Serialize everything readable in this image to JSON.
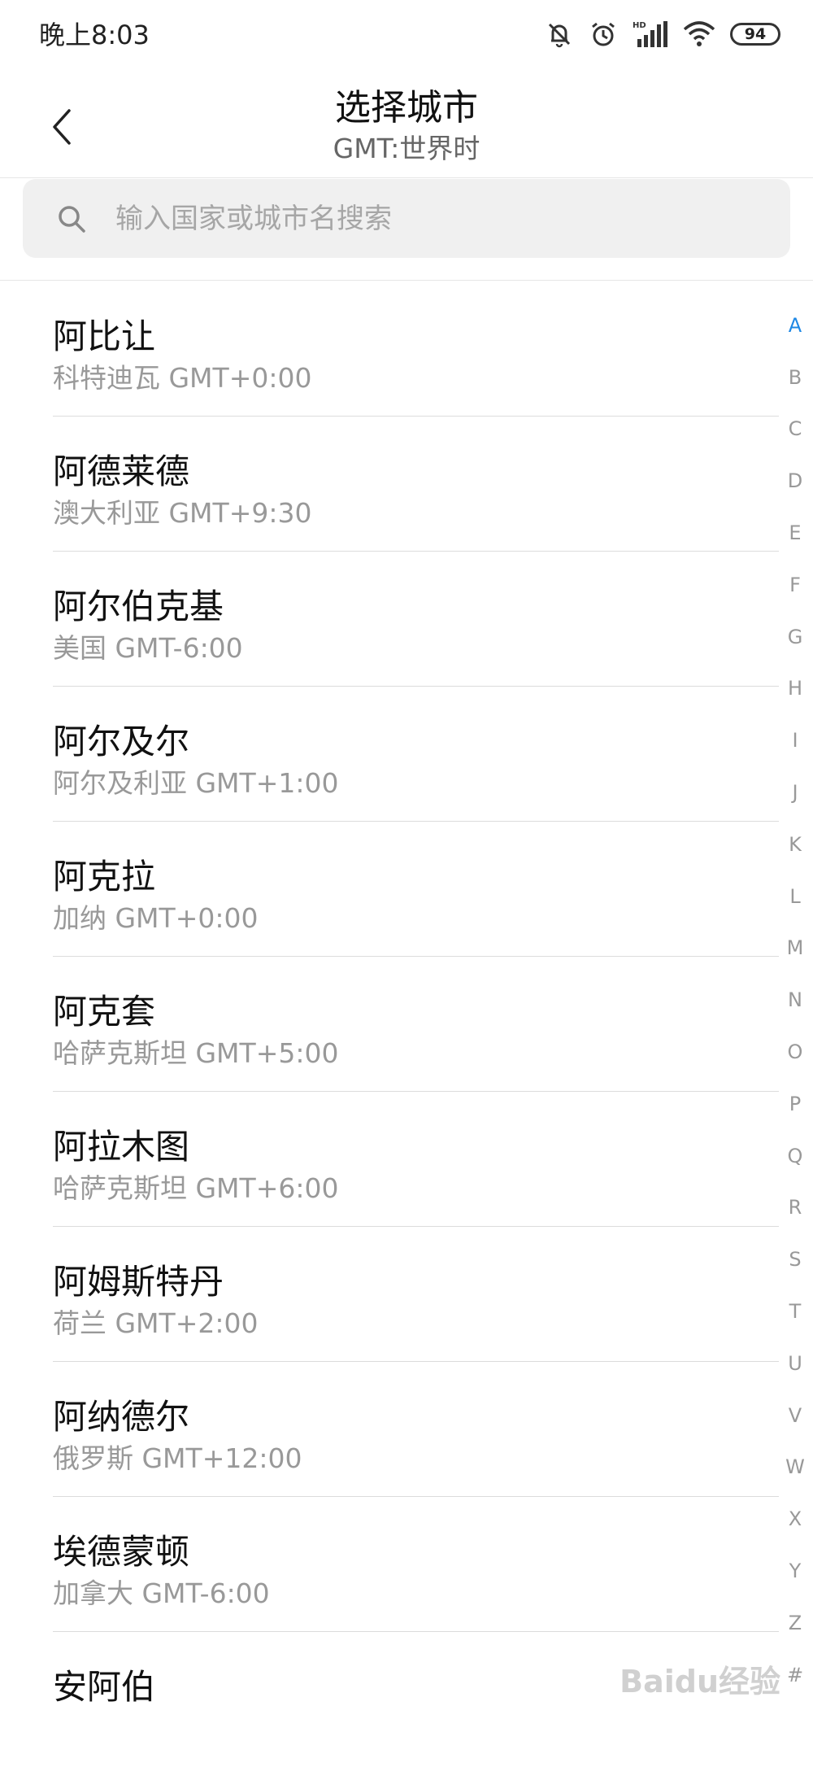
{
  "status": {
    "time": "晚上8:03",
    "battery": "94",
    "network_label": "HD"
  },
  "header": {
    "title": "选择城市",
    "subtitle": "GMT:世界时"
  },
  "search": {
    "placeholder": "输入国家或城市名搜索"
  },
  "cities": [
    {
      "name": "阿比让",
      "detail": "科特迪瓦 GMT+0:00"
    },
    {
      "name": "阿德莱德",
      "detail": "澳大利亚 GMT+9:30"
    },
    {
      "name": "阿尔伯克基",
      "detail": "美国 GMT-6:00"
    },
    {
      "name": "阿尔及尔",
      "detail": "阿尔及利亚 GMT+1:00"
    },
    {
      "name": "阿克拉",
      "detail": "加纳 GMT+0:00"
    },
    {
      "name": "阿克套",
      "detail": "哈萨克斯坦 GMT+5:00"
    },
    {
      "name": "阿拉木图",
      "detail": "哈萨克斯坦 GMT+6:00"
    },
    {
      "name": "阿姆斯特丹",
      "detail": "荷兰 GMT+2:00"
    },
    {
      "name": "阿纳德尔",
      "detail": "俄罗斯 GMT+12:00"
    },
    {
      "name": "埃德蒙顿",
      "detail": "加拿大 GMT-6:00"
    },
    {
      "name": "安阿伯",
      "detail": ""
    }
  ],
  "index": {
    "letters": [
      "A",
      "B",
      "C",
      "D",
      "E",
      "F",
      "G",
      "H",
      "I",
      "J",
      "K",
      "L",
      "M",
      "N",
      "O",
      "P",
      "Q",
      "R",
      "S",
      "T",
      "U",
      "V",
      "W",
      "X",
      "Y",
      "Z",
      "#"
    ],
    "active": "A",
    "active_color": "#1e88e5"
  },
  "watermark": "Baidu经验"
}
